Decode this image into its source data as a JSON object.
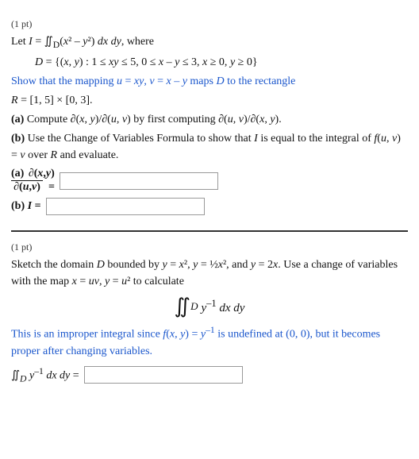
{
  "section1": {
    "pt_label": "(1 pt)",
    "intro_line1": "Let I = ∬_D(x² – y²) dx dy, where",
    "domain_def": "D = {(x, y) : 1 ≤ xy ≤ 5, 0 ≤ x – y ≤ 3, x ≥ 0, y ≥ 0}",
    "show_line": "Show that the mapping u = xy, v = x – y maps D to the rectangle",
    "rectangle": "R = [1, 5] × [0, 3].",
    "part_a_desc": "Compute ∂(x, y)/∂(u, v) by first computing ∂(u, v)/∂(x, y).",
    "part_b_desc": "Use the Change of Variables Formula to show that I is equal to the integral of f(u, v) = v over R, and evaluate.",
    "part_a_label": "(a)",
    "part_a_formula": "∂(x,y)/∂(u,v) =",
    "part_b_label": "(b)",
    "part_b_formula": "I ="
  },
  "section2": {
    "pt_label": "(1 pt)",
    "intro": "Sketch the domain D bounded by y = x², y = ½x², and y = 2x. Use a change of variables with the map x = uv, y = u² to calculate",
    "integral_display": "∬_D y⁻¹ dx dy",
    "note": "This is an improper integral since f(x, y) = y⁻¹ is undefined at (0, 0), but it becomes proper after changing variables.",
    "final_label": "∬_D y⁻¹ dx dy ="
  },
  "icons": {}
}
